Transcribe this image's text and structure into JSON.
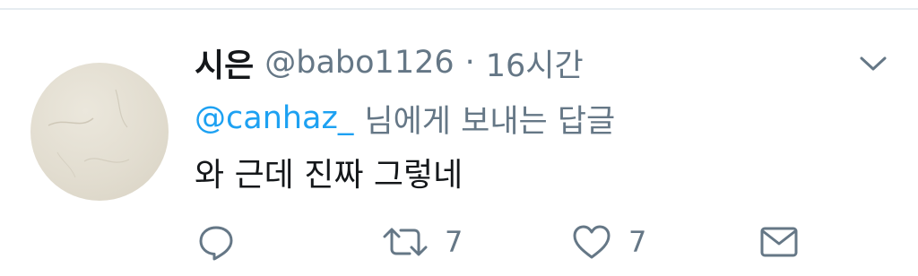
{
  "tweet": {
    "display_name": "시은",
    "handle": "@babo1126",
    "separator": "·",
    "time": "16시간",
    "reply_to": {
      "mention": "@canhaz_",
      "suffix": "님에게 보내는 답글"
    },
    "text": "와 근데 진짜 그렇네"
  },
  "actions": {
    "reply": {
      "icon": "comment-icon",
      "count": ""
    },
    "retweet": {
      "icon": "retweet-icon",
      "count": "7"
    },
    "like": {
      "icon": "heart-icon",
      "count": "7"
    },
    "message": {
      "icon": "envelope-icon",
      "count": ""
    }
  },
  "colors": {
    "text_primary": "#14171a",
    "text_secondary": "#657786",
    "link": "#1da1f2",
    "divider": "#e6ecf0",
    "icon": "#657786"
  }
}
